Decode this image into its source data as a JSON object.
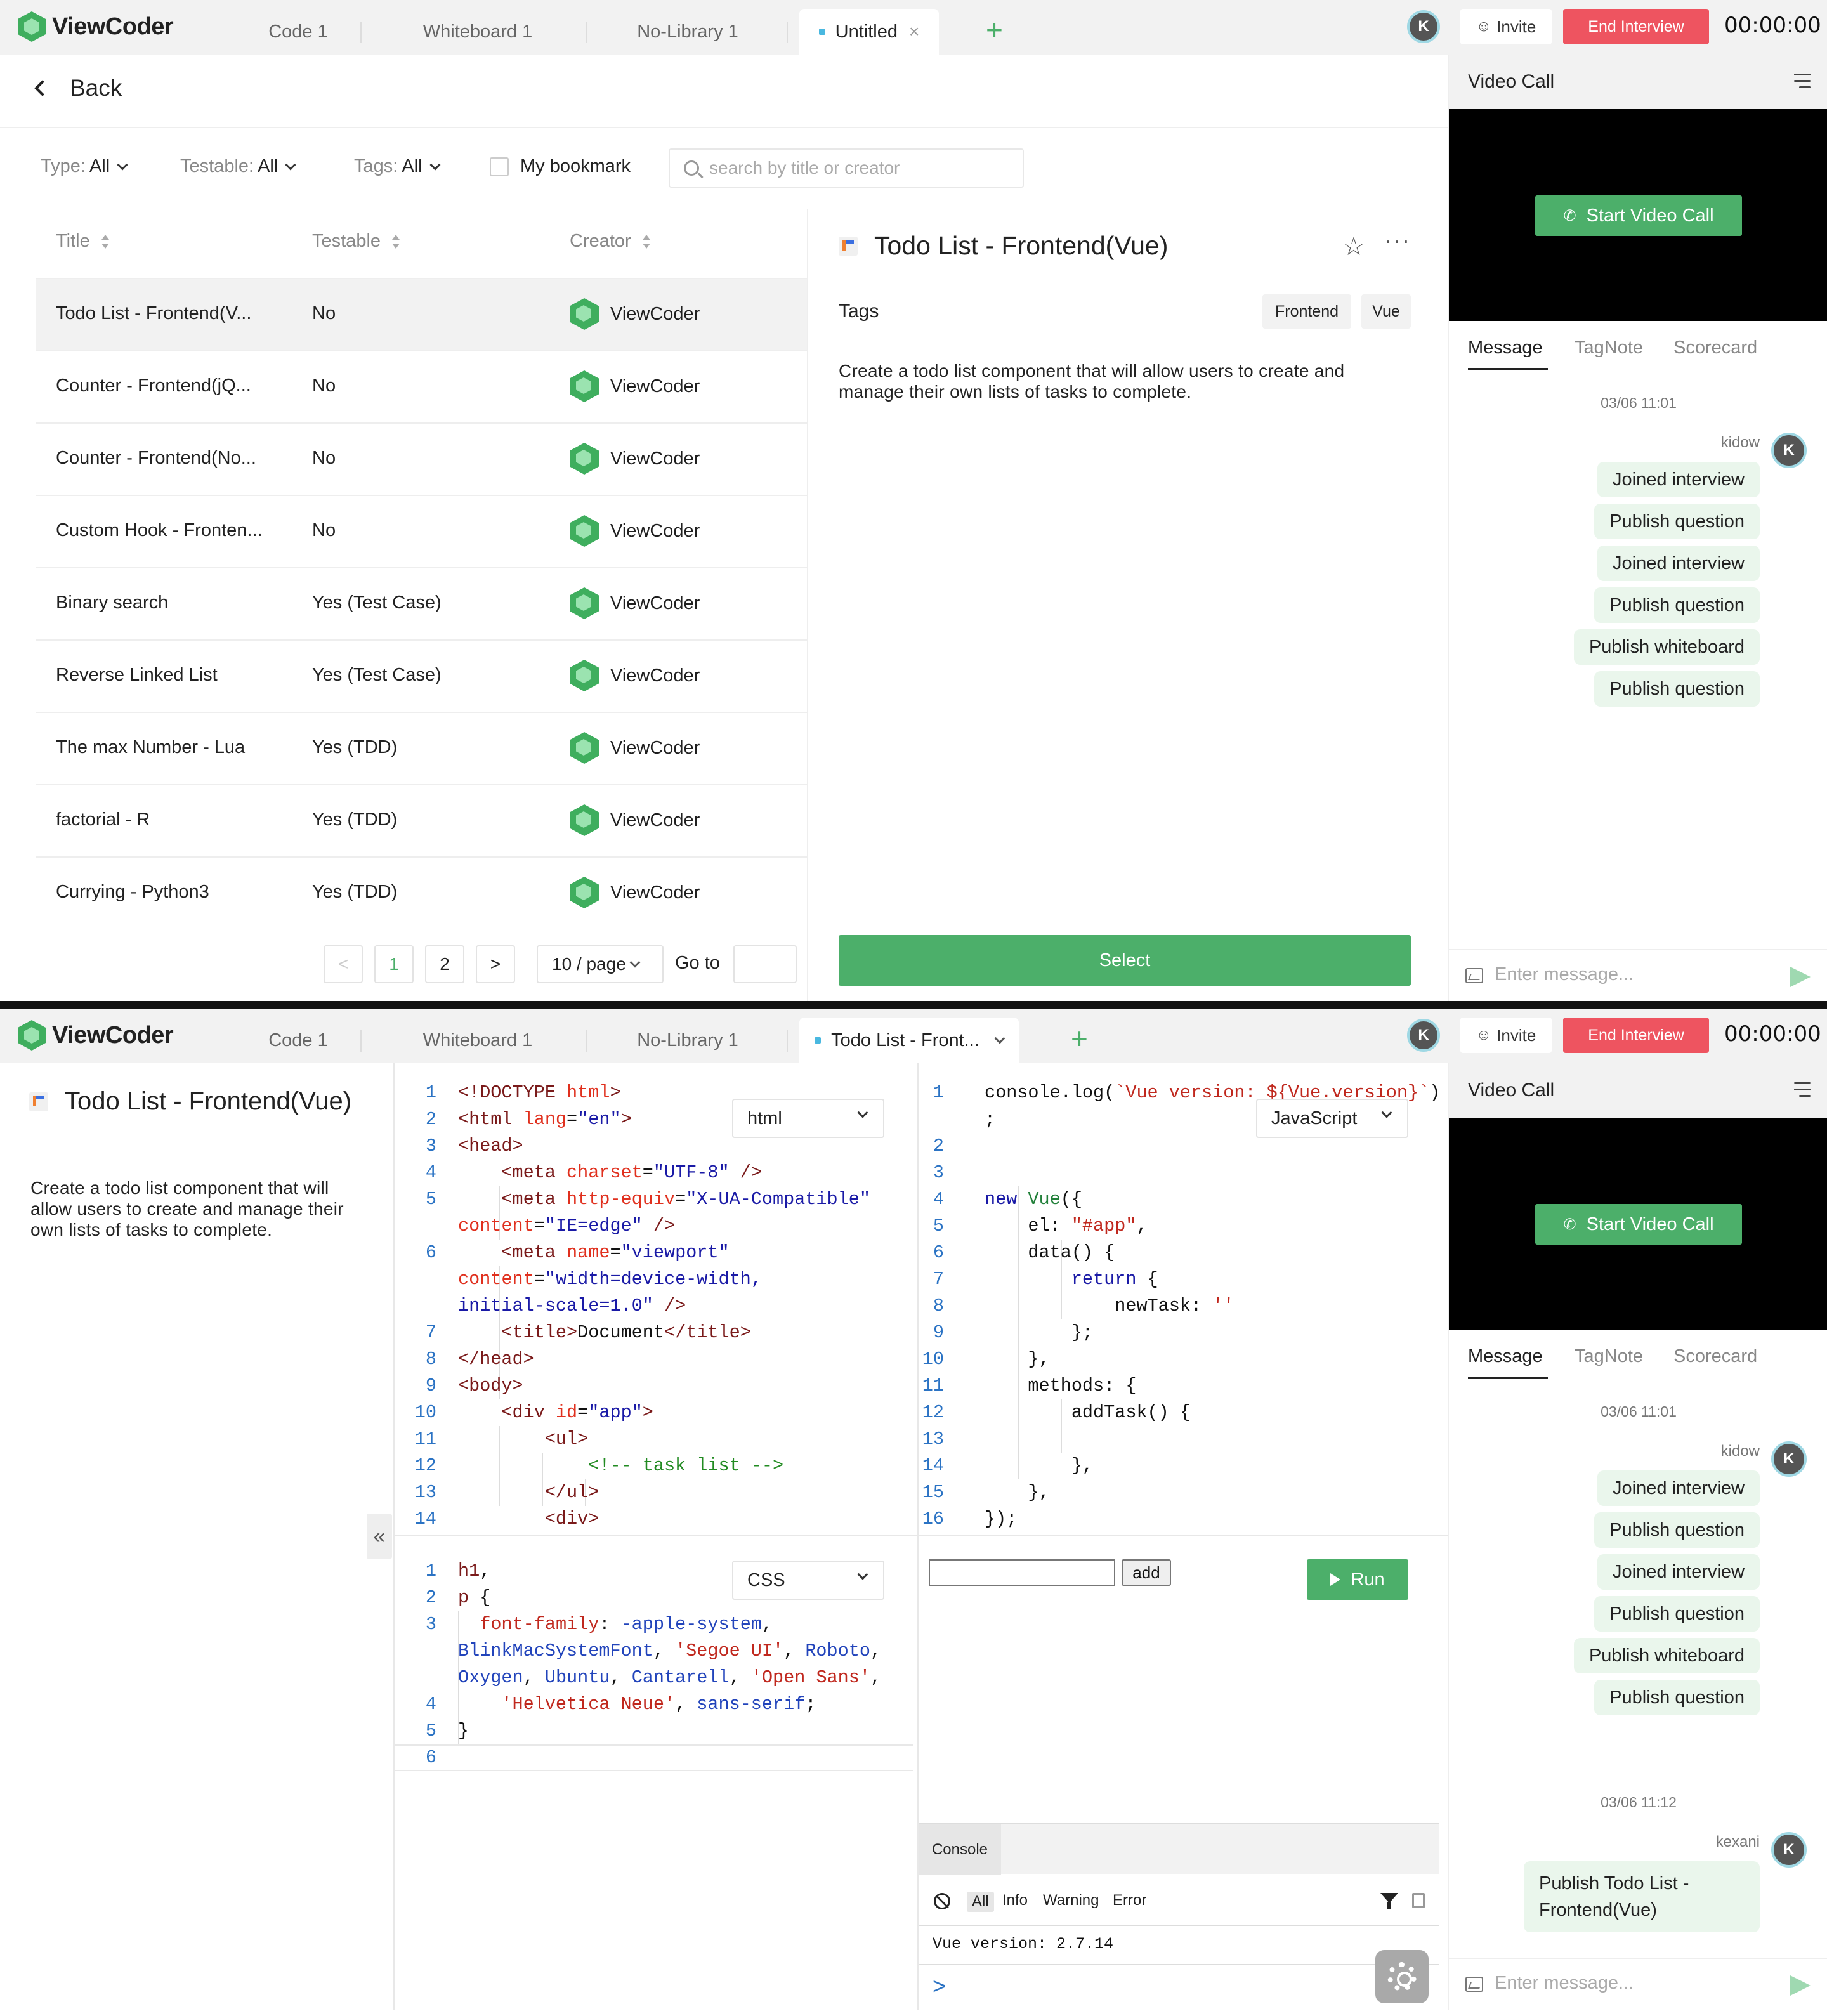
{
  "app": {
    "logo_text": "ViewCoder",
    "tabs": [
      "Code 1",
      "Whiteboard 1",
      "No-Library 1"
    ],
    "screen1_active_tab": "Untitled",
    "screen2_active_tab": "Todo List - Front...",
    "user_initial": "K",
    "invite_label": "Invite",
    "end_interview_label": "End Interview",
    "timer": "00:00:00",
    "accent_color": "#4caf6a",
    "danger_color": "#ee5460"
  },
  "side": {
    "video_title": "Video Call",
    "start_video_label": "Start Video Call",
    "chat_tabs": [
      "Message",
      "TagNote",
      "Scorecard"
    ],
    "input_placeholder": "Enter message...",
    "screen1_messages": {
      "date": "03/06 11:01",
      "user": "kidow",
      "user_initial": "K",
      "items": [
        "Joined interview",
        "Publish question",
        "Joined interview",
        "Publish question",
        "Publish whiteboard",
        "Publish question"
      ]
    },
    "screen2_messages": {
      "date1": "03/06 11:01",
      "user1": "kidow",
      "items": [
        "Joined interview",
        "Publish question",
        "Joined interview",
        "Publish question",
        "Publish whiteboard",
        "Publish question"
      ],
      "date2": "03/06 11:12",
      "user2": "kexani",
      "last": "Publish Todo List - Frontend(Vue)"
    }
  },
  "library": {
    "back_label": "Back",
    "filters": {
      "type_label": "Type:",
      "type_value": "All",
      "testable_label": "Testable:",
      "testable_value": "All",
      "tags_label": "Tags:",
      "tags_value": "All",
      "bookmark_label": "My bookmark",
      "search_placeholder": "search by title or creator"
    },
    "columns": [
      "Title",
      "Testable",
      "Creator"
    ],
    "rows": [
      {
        "title": "Todo List - Frontend(V...",
        "testable": "No",
        "creator": "ViewCoder"
      },
      {
        "title": "Counter - Frontend(jQ...",
        "testable": "No",
        "creator": "ViewCoder"
      },
      {
        "title": "Counter - Frontend(No...",
        "testable": "No",
        "creator": "ViewCoder"
      },
      {
        "title": "Custom Hook - Fronten...",
        "testable": "No",
        "creator": "ViewCoder"
      },
      {
        "title": "Binary search",
        "testable": "Yes (Test Case)",
        "creator": "ViewCoder"
      },
      {
        "title": "Reverse Linked List",
        "testable": "Yes (Test Case)",
        "creator": "ViewCoder"
      },
      {
        "title": "The max Number - Lua",
        "testable": "Yes (TDD)",
        "creator": "ViewCoder"
      },
      {
        "title": "factorial - R",
        "testable": "Yes (TDD)",
        "creator": "ViewCoder"
      },
      {
        "title": "Currying - Python3",
        "testable": "Yes (TDD)",
        "creator": "ViewCoder"
      }
    ],
    "pagination": {
      "prev": "<",
      "pages": [
        "1",
        "2"
      ],
      "next": ">",
      "page_size": "10 / page",
      "goto_label": "Go to"
    },
    "detail": {
      "title": "Todo List - Frontend(Vue)",
      "tags_label": "Tags",
      "tags": [
        "Frontend",
        "Vue"
      ],
      "description": "Create a todo list component that will allow users to create and manage their own lists of tasks to complete.",
      "select_label": "Select"
    }
  },
  "editor": {
    "title": "Todo List - Frontend(Vue)",
    "description": "Create a todo list component that will allow users to create and manage their own lists of tasks to complete.",
    "collapse_glyph": "«",
    "html_lang": "html",
    "css_lang": "CSS",
    "js_lang": "JavaScript",
    "run_label": "Run",
    "preview_add_label": "add",
    "console_tab": "Console",
    "console_levels": [
      "All",
      "Info",
      "Warning",
      "Error"
    ],
    "console_log": "Vue version: 2.7.14",
    "console_prompt": ">"
  }
}
